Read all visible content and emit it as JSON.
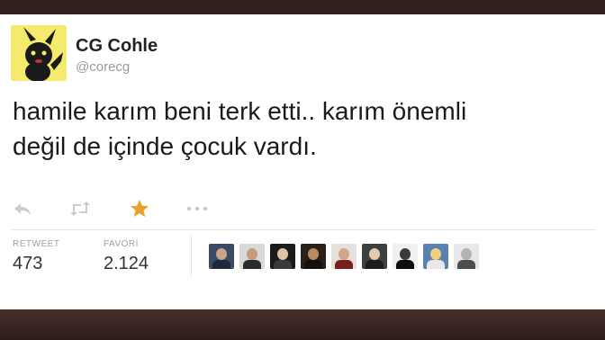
{
  "tweet": {
    "display_name": "CG Cohle",
    "handle": "@corecg",
    "text_line1": "hamile karım beni terk etti.. karım önemli",
    "text_line2": "değil de içinde çocuk vardı.",
    "avatar_icon": "pikachu-silhouette-icon"
  },
  "actions": [
    {
      "name": "reply-icon",
      "color": "#c8ccd0"
    },
    {
      "name": "retweet-icon",
      "color": "#c8ccd0"
    },
    {
      "name": "favorite-star-icon",
      "color": "#e8a32a"
    },
    {
      "name": "more-options-icon",
      "color": "#c8ccd0"
    }
  ],
  "stats": {
    "retweet_label": "RETWEET",
    "retweet_count": "473",
    "favorite_label": "FAVORİ",
    "favorite_count": "2.124"
  },
  "favoriters": [
    {
      "name": "favoriter-avatar-1",
      "bg": "#3b4a66",
      "skin": "#caa38a",
      "shirt": "#20283a"
    },
    {
      "name": "favoriter-avatar-2",
      "bg": "#d9d9d9",
      "skin": "#c99a7c",
      "shirt": "#2b2b2b"
    },
    {
      "name": "favoriter-avatar-3",
      "bg": "#1b1b1b",
      "skin": "#e0c2a8",
      "shirt": "#3a3a3a"
    },
    {
      "name": "favoriter-avatar-4",
      "bg": "#2a2018",
      "skin": "#b88a62",
      "shirt": "#111111"
    },
    {
      "name": "favoriter-avatar-5",
      "bg": "#e5e0da",
      "skin": "#d3a68a",
      "shirt": "#7a1e1e"
    },
    {
      "name": "favoriter-avatar-6",
      "bg": "#3f3f3f",
      "skin": "#e2c9b4",
      "shirt": "#1c1c1c"
    },
    {
      "name": "favoriter-avatar-7",
      "bg": "#f0f0f0",
      "skin": "#3a3a3a",
      "shirt": "#0f0f0f"
    },
    {
      "name": "favoriter-avatar-8",
      "bg": "#5a7fb0",
      "skin": "#f0d080",
      "shirt": "#e8e8e8"
    },
    {
      "name": "favoriter-avatar-9",
      "bg": "#e8e8e8",
      "skin": "#b3b3b3",
      "shirt": "#4d4d4d"
    }
  ]
}
